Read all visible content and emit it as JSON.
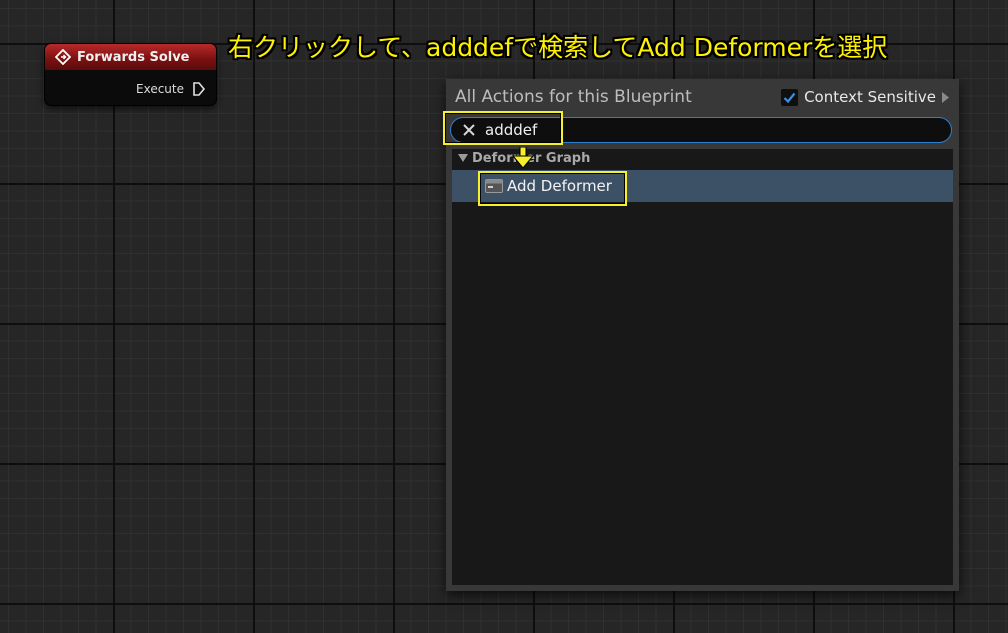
{
  "caption": "右クリックして、adddefで検索してAdd Deformerを選択",
  "node": {
    "title": "Forwards Solve",
    "pin_label": "Execute",
    "header_icon": "function-diamond-icon",
    "pin_icon": "exec-pin-icon"
  },
  "menu": {
    "title": "All Actions for this Blueprint",
    "context_sensitive": {
      "label": "Context Sensitive",
      "checked": true
    },
    "search": {
      "value": "adddef"
    },
    "category": {
      "label": "Deformer Graph"
    },
    "items": [
      {
        "label": "Add Deformer",
        "icon": "node-function-icon"
      }
    ]
  },
  "colors": {
    "highlight": "#f5f02b",
    "node_header": "#9a1c1c",
    "selected_row": "#3d5166",
    "search_border": "#2f7fd0"
  }
}
